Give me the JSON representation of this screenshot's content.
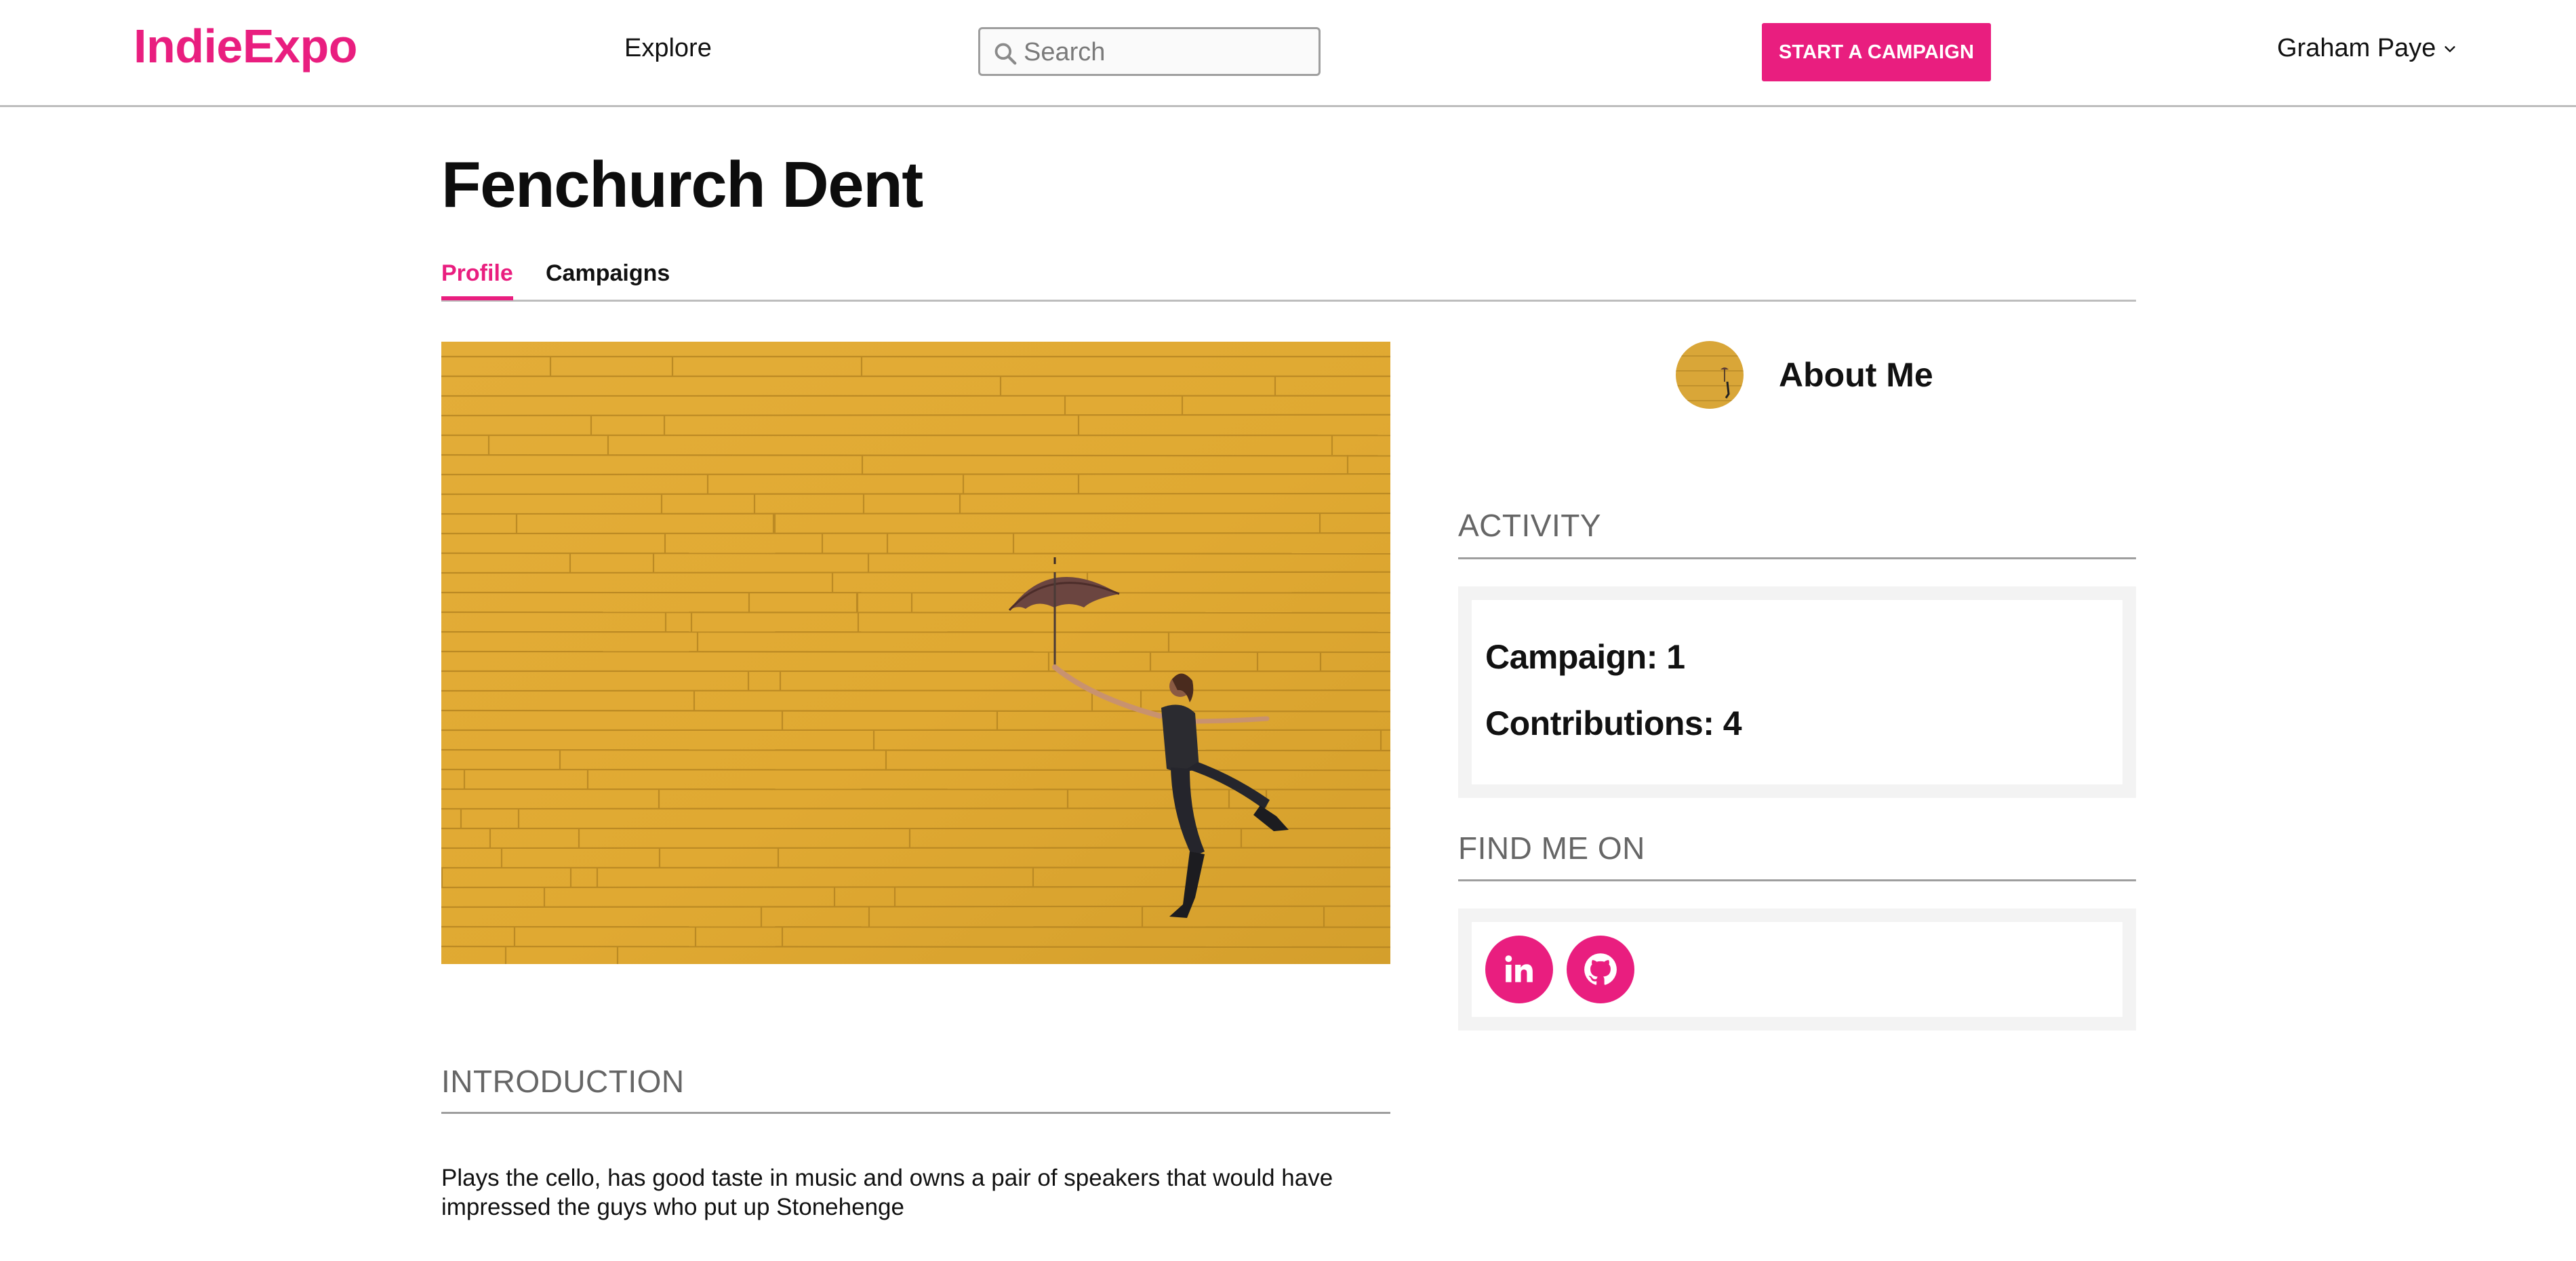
{
  "header": {
    "logo": "IndieExpo",
    "nav_explore": "Explore",
    "search_placeholder": "Search",
    "cta_label": "START A CAMPAIGN",
    "user_name": "Graham Paye"
  },
  "profile": {
    "name": "Fenchurch Dent",
    "tabs": [
      {
        "label": "Profile",
        "active": true
      },
      {
        "label": "Campaigns",
        "active": false
      }
    ]
  },
  "about": {
    "title": "About Me"
  },
  "activity": {
    "heading": "ACTIVITY",
    "campaign_line": "Campaign: 1",
    "contributions_line": "Contributions: 4"
  },
  "social": {
    "heading": "FIND ME ON",
    "links": [
      "linkedin-icon",
      "github-icon"
    ]
  },
  "introduction": {
    "heading": "INTRODUCTION",
    "text": "Plays the cello, has good taste in music and owns a pair of speakers that would have impressed the guys who put up Stonehenge"
  },
  "colors": {
    "accent": "#e91e7f",
    "hero_wall": "#e0ab35",
    "panel_bg": "#f3f3f3",
    "heading_grey": "#666666"
  }
}
